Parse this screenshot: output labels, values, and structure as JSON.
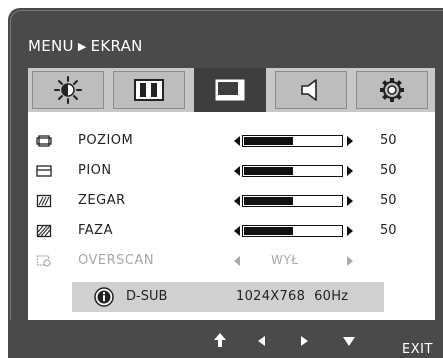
{
  "header": {
    "menu_label": "MENU",
    "separator_icon": "triangle-right-icon",
    "current_label": "EKRAN"
  },
  "tabs": [
    {
      "icon": "brightness-sun-icon",
      "active": false
    },
    {
      "icon": "color-bars-icon",
      "active": false
    },
    {
      "icon": "screen-position-icon",
      "active": true
    },
    {
      "icon": "speaker-icon",
      "active": false
    },
    {
      "icon": "settings-gear-icon",
      "active": false
    }
  ],
  "rows": [
    {
      "icon": "horizontal-position-icon",
      "label": "POZIOM",
      "value": "50",
      "level": 50
    },
    {
      "icon": "vertical-position-icon",
      "label": "PION",
      "value": "50",
      "level": 50
    },
    {
      "icon": "clock-icon",
      "label": "ZEGAR",
      "value": "50",
      "level": 50
    },
    {
      "icon": "phase-icon",
      "label": "FAZA",
      "value": "50",
      "level": 50
    }
  ],
  "overscan": {
    "icon": "overscan-icon",
    "label": "OVERSCAN",
    "value": "WYŁ",
    "enabled": false
  },
  "info": {
    "icon": "info-icon",
    "input": "D-SUB",
    "resolution": "1024X768",
    "frequency": "60Hz"
  },
  "footer": {
    "controls": [
      "enter-up-arrow-icon",
      "left-arrow-icon",
      "right-arrow-icon",
      "down-arrow-icon"
    ],
    "exit_label": "EXIT"
  }
}
